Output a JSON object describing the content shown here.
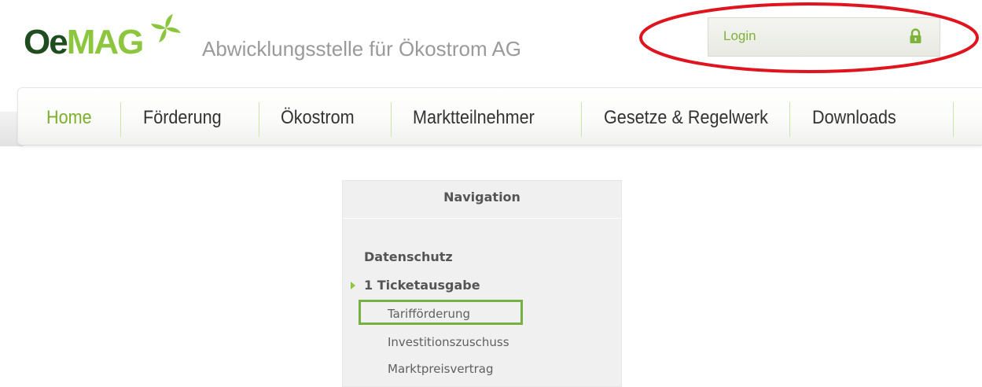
{
  "header": {
    "logo_oe": "Oe",
    "logo_mag": "MAG",
    "tagline": "Abwicklungsstelle für Ökostrom AG",
    "logo_icon": "pinwheel-icon"
  },
  "login": {
    "label": "Login",
    "icon": "lock-icon"
  },
  "main_nav": {
    "items": [
      {
        "label": "Home",
        "active": true
      },
      {
        "label": "Förderung",
        "active": false
      },
      {
        "label": "Ökostrom",
        "active": false
      },
      {
        "label": "Marktteilnehmer",
        "active": false
      },
      {
        "label": "Gesetze & Regelwerk",
        "active": false
      },
      {
        "label": "Downloads",
        "active": false
      }
    ]
  },
  "side_nav": {
    "title": "Navigation",
    "items": [
      {
        "label": "Datenschutz",
        "level": 0
      },
      {
        "label": "1 Ticketausgabe",
        "level": 0,
        "expanded": true
      },
      {
        "label": "Tarifförderung",
        "level": 1,
        "highlighted": true
      },
      {
        "label": "Investitionszuschuss",
        "level": 1
      },
      {
        "label": "Marktpreisvertrag",
        "level": 1
      }
    ]
  },
  "colors": {
    "brand_green": "#8cc63f",
    "brand_dark": "#1f4d1f",
    "active_nav": "#7cb02b",
    "annotation_red": "#e0141e",
    "annotation_green": "#77b043"
  }
}
